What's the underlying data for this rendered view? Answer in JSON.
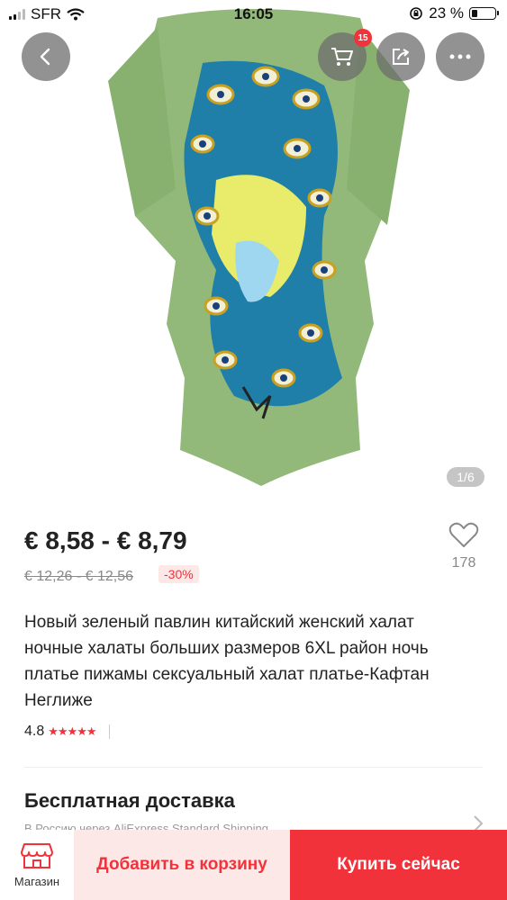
{
  "status_bar": {
    "carrier": "SFR",
    "time": "16:05",
    "battery": "23 %"
  },
  "gallery": {
    "counter": "1/6",
    "cart_badge": "15"
  },
  "product": {
    "price": "€ 8,58 - € 8,79",
    "old_price": "€ 12,26 - € 12,56",
    "discount": "-30%",
    "wishlist_count": "178",
    "title": "Новый зеленый павлин китайский женский халат ночные халаты больших размеров 6XL район ночь платье пижамы сексуальный халат платье-Кафтан Неглиже",
    "rating": "4.8",
    "stars": "★★★★★"
  },
  "shipping": {
    "title": "Бесплатная доставка",
    "subtitle": "В Россию через AliExpress Standard Shipping"
  },
  "bottom_bar": {
    "store_label": "Магазин",
    "add_to_cart": "Добавить в корзину",
    "buy_now": "Купить сейчас"
  },
  "colors": {
    "accent": "#f2323a",
    "accent_light": "#fde8e8"
  }
}
